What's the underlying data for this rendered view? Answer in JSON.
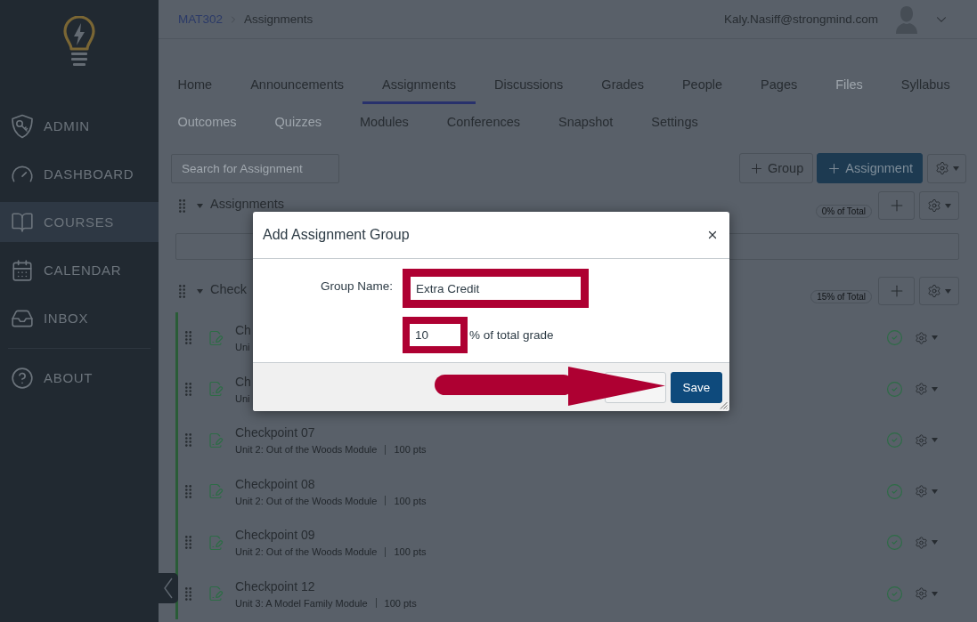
{
  "sidebar": {
    "items": [
      {
        "label": "ADMIN",
        "selected": false
      },
      {
        "label": "DASHBOARD",
        "selected": false
      },
      {
        "label": "COURSES",
        "selected": true
      },
      {
        "label": "CALENDAR",
        "selected": false
      },
      {
        "label": "INBOX",
        "selected": false
      }
    ],
    "bottom_items": [
      {
        "label": "ABOUT",
        "selected": false
      }
    ]
  },
  "header": {
    "breadcrumb": [
      {
        "label": "MAT302",
        "kind": "link"
      },
      {
        "label": "Assignments",
        "kind": "current"
      }
    ],
    "user_email": "Kaly.Nasiff@strongmind.com"
  },
  "course_nav": {
    "rows": [
      {
        "tabs": [
          {
            "label": "Home",
            "selected": false,
            "disabled": false
          },
          {
            "label": "Announcements",
            "selected": false,
            "disabled": false
          },
          {
            "label": "Assignments",
            "selected": true,
            "disabled": false
          },
          {
            "label": "Discussions",
            "selected": false,
            "disabled": false
          },
          {
            "label": "Grades",
            "selected": false,
            "disabled": false
          },
          {
            "label": "People",
            "selected": false,
            "disabled": false
          },
          {
            "label": "Pages",
            "selected": false,
            "disabled": false
          },
          {
            "label": "Files",
            "selected": false,
            "disabled": true
          },
          {
            "label": "Syllabus",
            "selected": false,
            "disabled": false
          }
        ]
      },
      {
        "tabs": [
          {
            "label": "Outcomes",
            "selected": false,
            "disabled": true
          },
          {
            "label": "Quizzes",
            "selected": false,
            "disabled": true
          },
          {
            "label": "Modules",
            "selected": false,
            "disabled": false
          },
          {
            "label": "Conferences",
            "selected": false,
            "disabled": false
          },
          {
            "label": "Snapshot",
            "selected": false,
            "disabled": false
          },
          {
            "label": "Settings",
            "selected": false,
            "disabled": false
          }
        ]
      }
    ]
  },
  "toolbar": {
    "search": {
      "placeholder": "Search for Assignment"
    },
    "buttons": [
      {
        "label": "Group",
        "kind": "secondary"
      },
      {
        "label": "Assignment",
        "kind": "primary"
      }
    ]
  },
  "groups": [
    {
      "title": "Assignments",
      "expanded": true,
      "weight": "0% of Total"
    },
    {
      "title": "Check",
      "expanded": true,
      "weight": "15% of Total",
      "items": [
        {
          "title": "Ch",
          "module": "Uni",
          "published": true
        },
        {
          "title": "Ch",
          "module": "Uni",
          "published": true
        },
        {
          "title": "Checkpoint 07",
          "module": "Unit 2: Out of the Woods Module",
          "points": "100 pts",
          "published": true
        },
        {
          "title": "Checkpoint 08",
          "module": "Unit 2: Out of the Woods Module",
          "points": "100 pts",
          "published": true
        },
        {
          "title": "Checkpoint 09",
          "module": "Unit 2: Out of the Woods Module",
          "points": "100 pts",
          "published": true
        },
        {
          "title": "Checkpoint 12",
          "module": "Unit 3: A Model Family Module",
          "points": "100 pts",
          "published": true
        }
      ]
    }
  ],
  "dialog": {
    "title": "Add Assignment Group",
    "fields": [
      {
        "label": "Group Name:",
        "value": "Extra Credit",
        "highlighted": true
      },
      {
        "value": "10",
        "suffix": "% of total grade",
        "highlighted": true
      }
    ],
    "buttons": [
      {
        "kind": "secondary"
      },
      {
        "label": "Save",
        "kind": "primary"
      }
    ]
  }
}
